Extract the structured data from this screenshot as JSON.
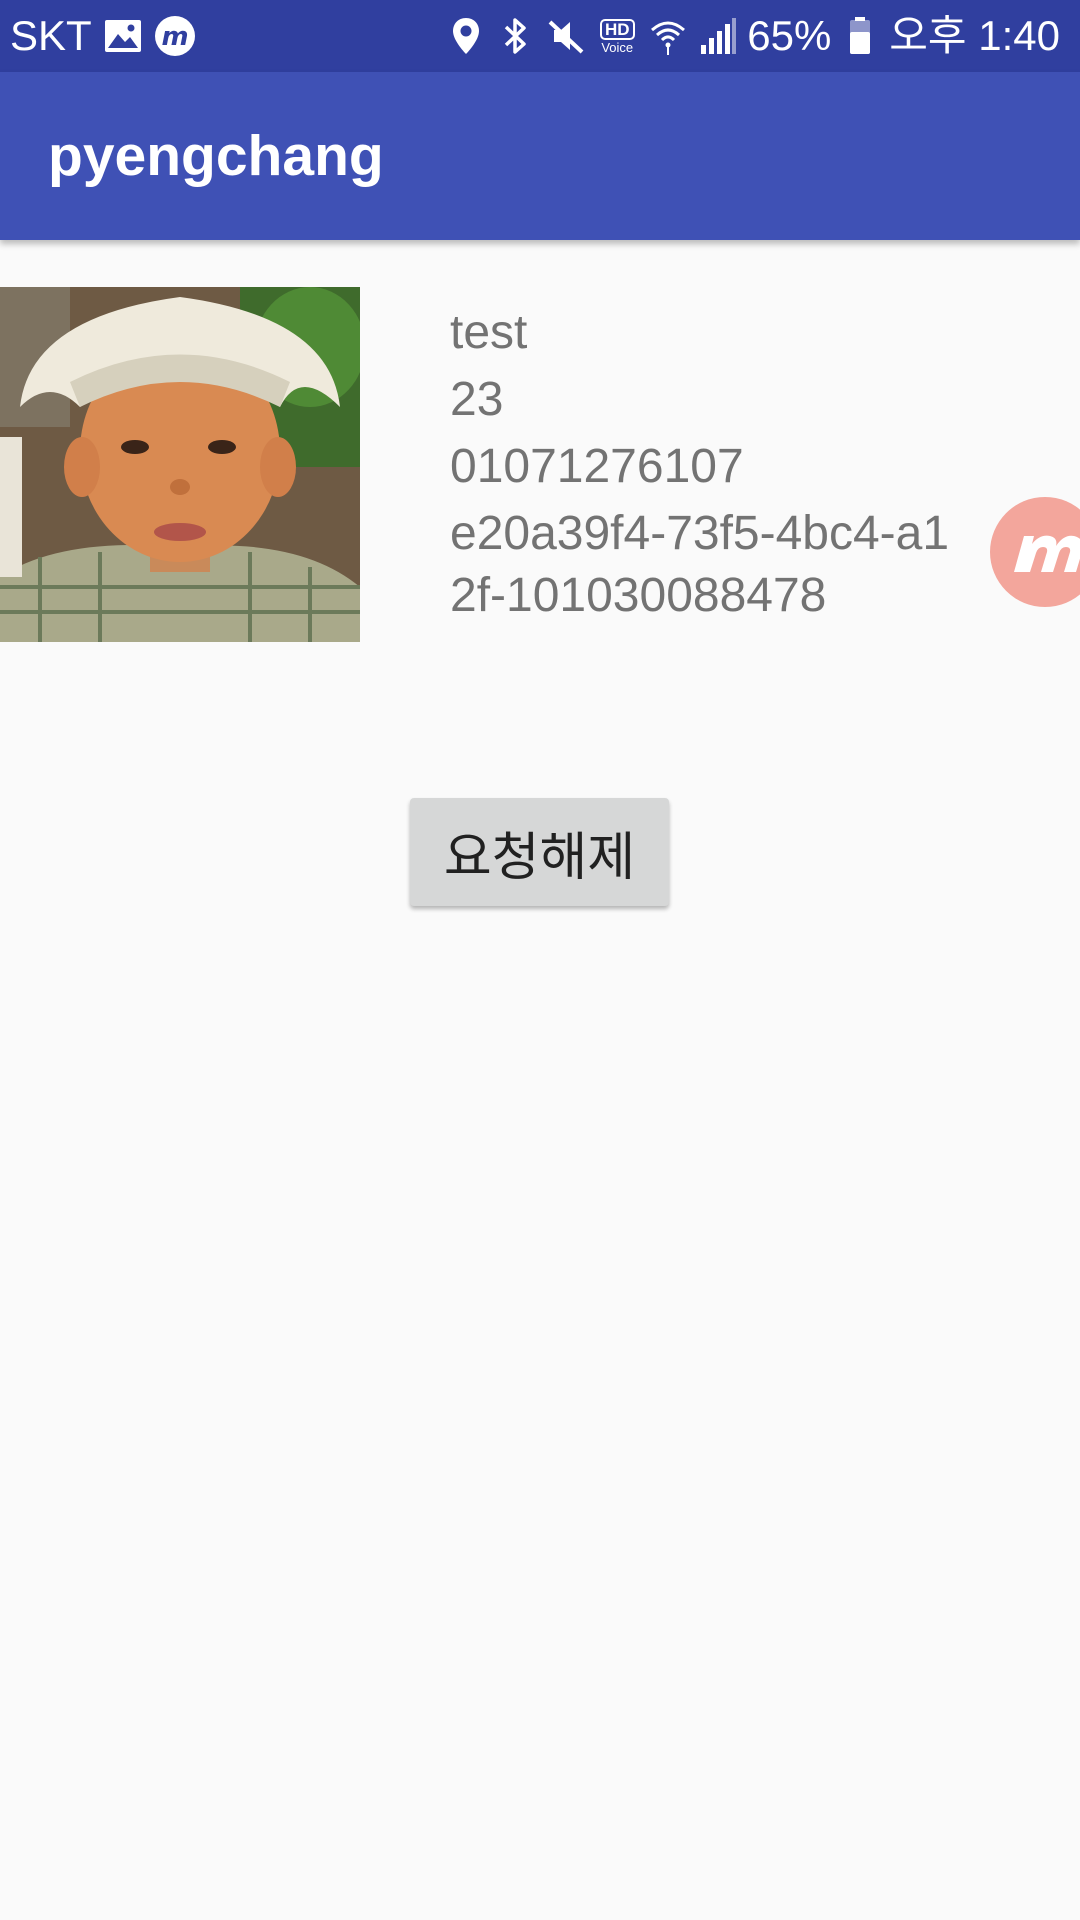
{
  "status_bar": {
    "carrier": "SKT",
    "battery": "65%",
    "time": "오후 1:40",
    "hd_label": "HD",
    "voice_label": "Voice",
    "icons": [
      "gallery-icon",
      "m-app-icon",
      "location-icon",
      "bluetooth-icon",
      "mute-icon",
      "hd-voice-icon",
      "wifi-icon",
      "signal-icon",
      "battery-icon"
    ]
  },
  "app_bar": {
    "title": "pyengchang"
  },
  "profile": {
    "name": "test",
    "age": "23",
    "phone": "01071276107",
    "id": "e20a39f4-73f5-4bc4-a12f-101030088478"
  },
  "button": {
    "label": "요청해제"
  },
  "colors": {
    "status_bar": "#303f9f",
    "app_bar": "#3f51b5",
    "background": "#fafafa",
    "button": "#d6d7d7",
    "info_text": "#737373",
    "floating_badge": "#f3a69c"
  }
}
